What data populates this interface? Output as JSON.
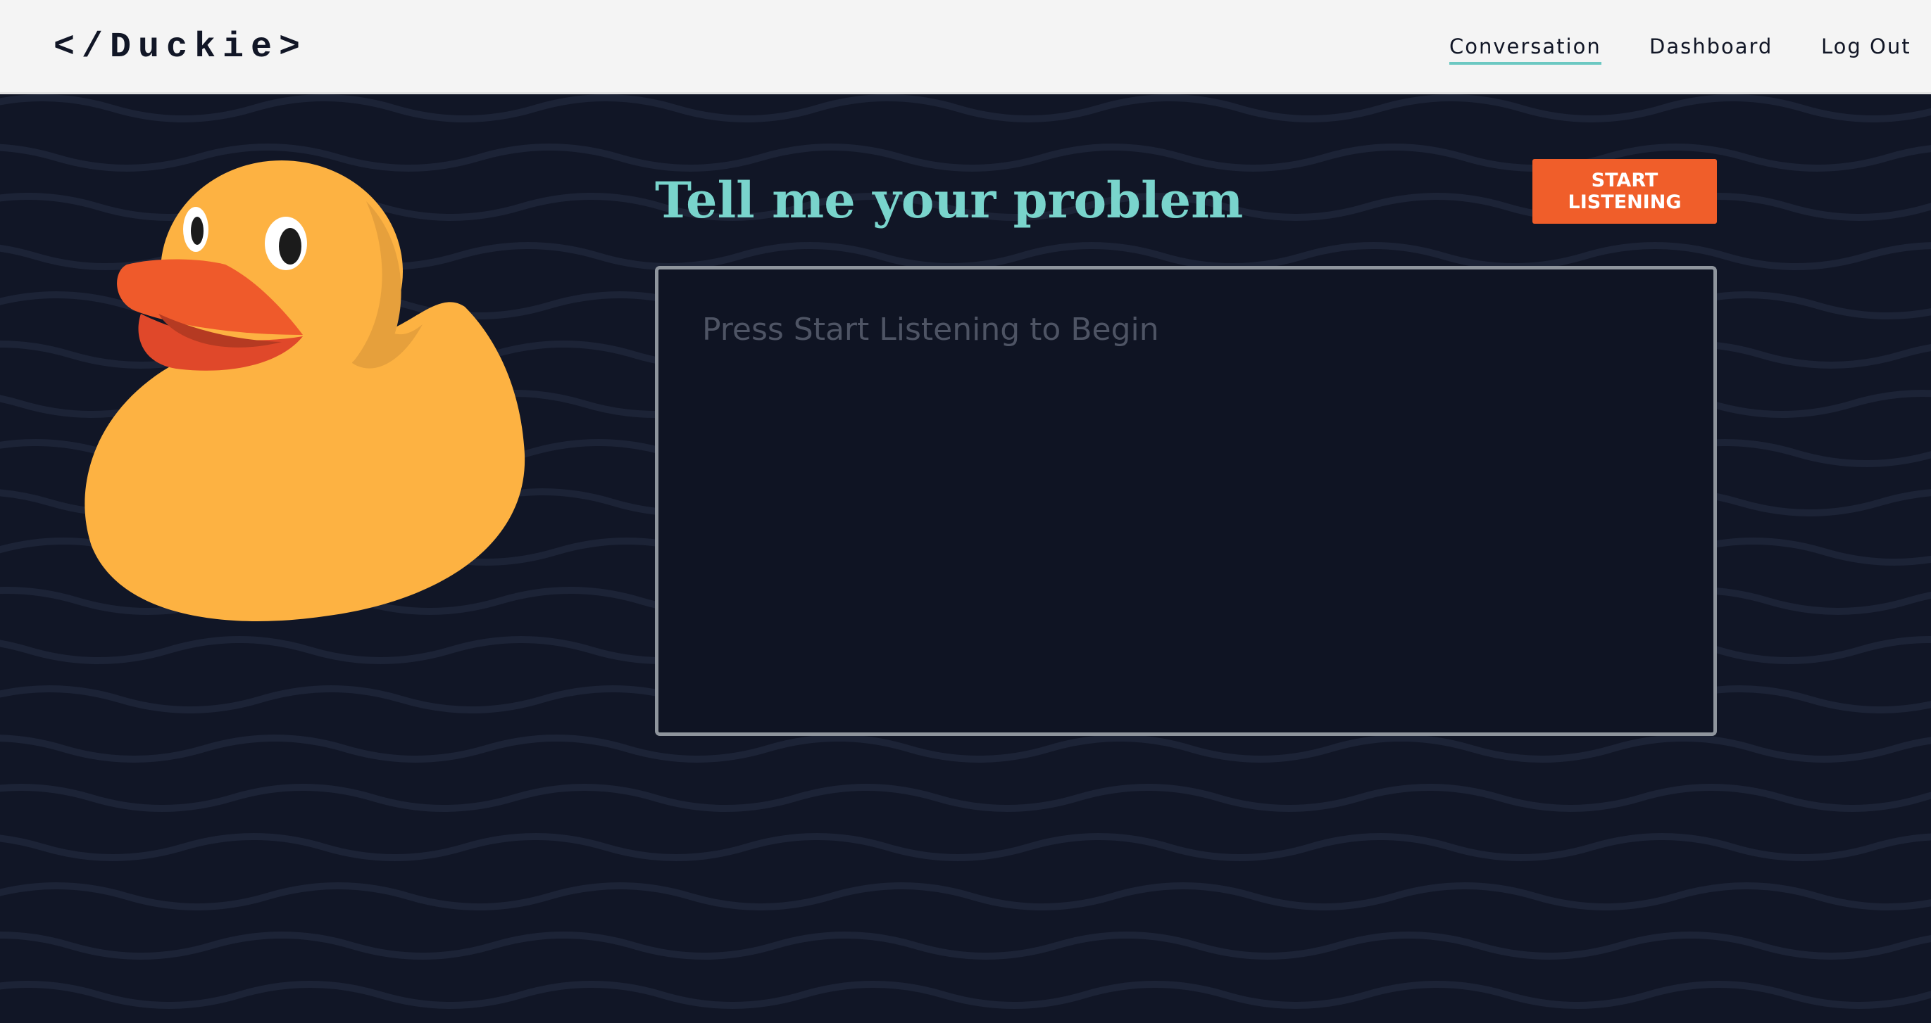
{
  "app": {
    "logo_text": "</Duckie>"
  },
  "nav": {
    "items": [
      {
        "label": "Conversation",
        "active": true
      },
      {
        "label": "Dashboard",
        "active": false
      },
      {
        "label": "Log Out",
        "active": false
      }
    ]
  },
  "main": {
    "heading": "Tell me your problem",
    "start_button_label": "START LISTENING",
    "transcript_placeholder": "Press Start Listening to Begin"
  },
  "theme": {
    "background": "#111626",
    "navbar": "#f4f4f4",
    "accent_teal": "#79d4cc",
    "button_orange": "#f05e2a",
    "duck_yellow": "#fdb242"
  },
  "icons": {
    "mascot": "rubber-duck"
  }
}
